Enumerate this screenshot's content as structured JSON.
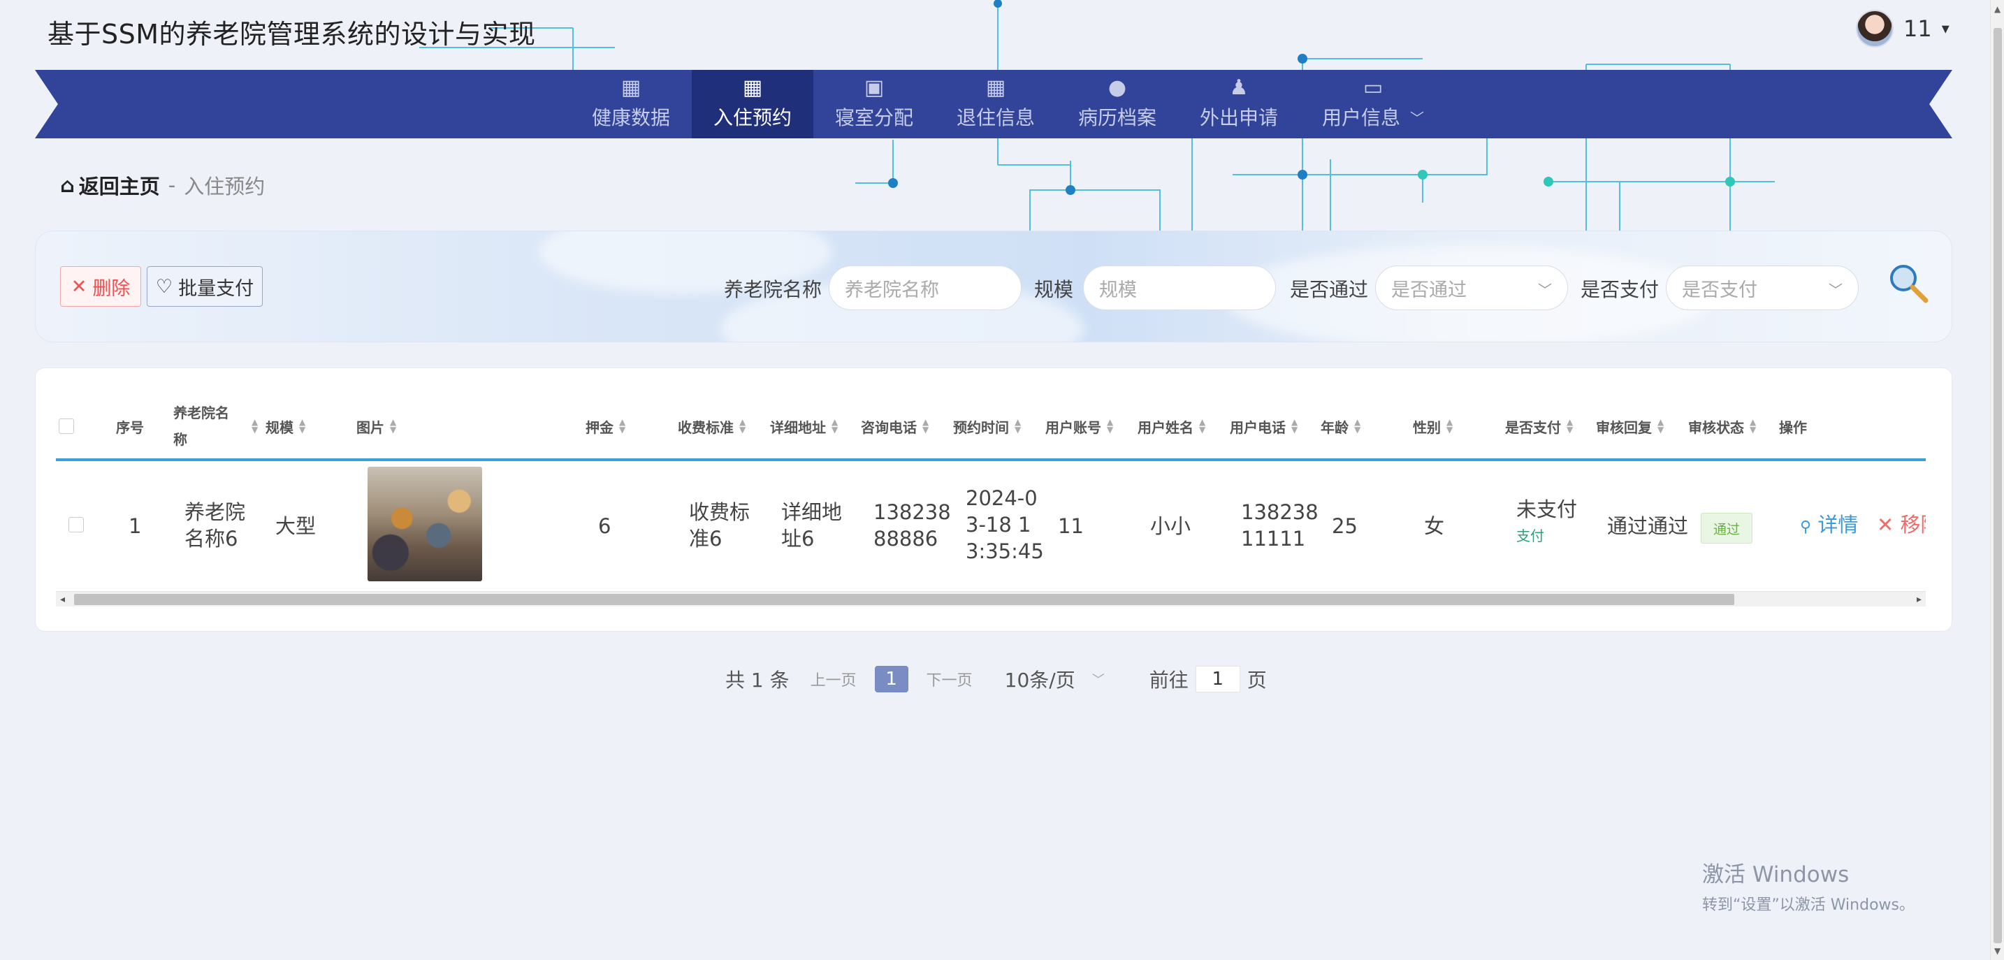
{
  "site": {
    "title": "基于SSM的养老院管理系统的设计与实现",
    "user_name": "11",
    "user_caret": "▾"
  },
  "nav": {
    "items": [
      {
        "label": "健康数据",
        "icon": "grid-icon",
        "active": false
      },
      {
        "label": "入住预约",
        "icon": "grid-icon",
        "active": true
      },
      {
        "label": "寝室分配",
        "icon": "clipboard-check-icon",
        "active": false
      },
      {
        "label": "退住信息",
        "icon": "grid-icon",
        "active": false
      },
      {
        "label": "病历档案",
        "icon": "lightbulb-icon",
        "active": false
      },
      {
        "label": "外出申请",
        "icon": "user-icon",
        "active": false
      },
      {
        "label": "用户信息",
        "icon": "card-icon",
        "active": false
      }
    ],
    "dropdown_glyph": "﹀"
  },
  "breadcrumb": {
    "home": "返回主页",
    "separator": "-",
    "current": "入住预约"
  },
  "toolbar": {
    "delete_label": "删除",
    "pay_label": "批量支付"
  },
  "filters": {
    "name_label": "养老院名称",
    "name_placeholder": "养老院名称",
    "scale_label": "规模",
    "scale_placeholder": "规模",
    "passed_label": "是否通过",
    "passed_placeholder": "是否通过",
    "paid_label": "是否支付",
    "paid_placeholder": "是否支付"
  },
  "table": {
    "columns": [
      "序号",
      "养老院名",
      "称",
      "规模",
      "图片",
      "押金",
      "收费标准",
      "详细地址",
      "咨询电话",
      "预约时间",
      "用户账号",
      "用户姓名",
      "用户电话",
      "年龄",
      "性别",
      "是否支付",
      "审核回复",
      "审核状态",
      "操作"
    ],
    "rows": [
      {
        "index": "1",
        "name_l1": "养老院",
        "name_l2": "名称6",
        "scale": "大型",
        "deposit": "6",
        "fee_l1": "收费标",
        "fee_l2": "准6",
        "addr_l1": "详细地",
        "addr_l2": "址6",
        "phone_l1": "138238",
        "phone_l2": "88886",
        "time_l1": "2024-0",
        "time_l2": "3-18 1",
        "time_l3": "3:35:45",
        "account": "11",
        "username": "小小",
        "uphone_l1": "138238",
        "uphone_l2": "11111",
        "age": "25",
        "gender": "女",
        "paid": "未支付",
        "pay_action": "支付",
        "reply": "通过通过",
        "status": "通过",
        "detail": "详情",
        "remove": "移除"
      }
    ]
  },
  "pagination": {
    "total": "共 1 条",
    "prev": "上一页",
    "current": "1",
    "next": "下一页",
    "page_size": "10条/页",
    "goto_prefix": "前往",
    "goto_value": "1",
    "goto_suffix": "页"
  },
  "watermark": {
    "line1": "激活 Windows",
    "line2": "转到“设置”以激活 Windows。"
  },
  "colors": {
    "nav_bg": "#31449a",
    "nav_active": "#1f2f7a",
    "accent_line": "#3aa0d8",
    "delete_red": "#f05050",
    "pass_green": "#67b143"
  }
}
